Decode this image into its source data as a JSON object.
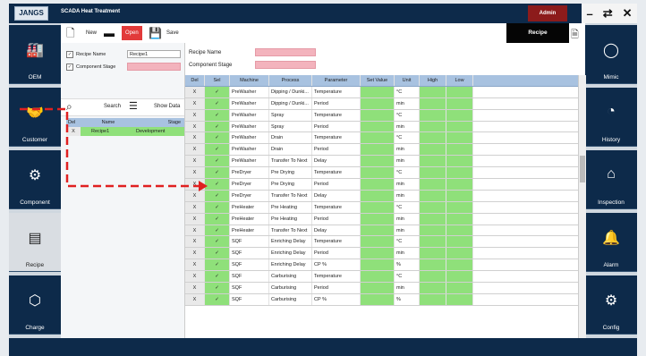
{
  "app": {
    "logo": "JANGS",
    "title": "SCADA Heat Treatment",
    "user_badge": "Admin"
  },
  "window_controls": {
    "minimize": "–",
    "restore": "⇄",
    "close": "✕"
  },
  "left_nav": [
    {
      "label": "OEM",
      "icon": "factory-icon",
      "glyph": "🏭",
      "active": false
    },
    {
      "label": "Customer",
      "icon": "customer-icon",
      "glyph": "🤝",
      "active": false
    },
    {
      "label": "Component",
      "icon": "component-icon",
      "glyph": "⚙",
      "active": false
    },
    {
      "label": "Recipe",
      "icon": "recipe-icon",
      "glyph": "▤",
      "active": true
    },
    {
      "label": "Charge",
      "icon": "charge-icon",
      "glyph": "⬡",
      "active": false
    }
  ],
  "right_nav": [
    {
      "label": "Mimic",
      "icon": "mimic-icon",
      "glyph": "◯"
    },
    {
      "label": "History",
      "icon": "history-icon",
      "glyph": "◔"
    },
    {
      "label": "Inspection",
      "icon": "inspection-icon",
      "glyph": "⌂"
    },
    {
      "label": "Alarm",
      "icon": "alarm-icon",
      "glyph": "🔔"
    },
    {
      "label": "Config",
      "icon": "config-icon",
      "glyph": "⚙"
    }
  ],
  "toolbar": {
    "new_label": "New",
    "open_label": "Open",
    "save_label": "Save",
    "section_title": "Recipe"
  },
  "left_panel": {
    "recipe_name_label": "Recipe Name",
    "recipe_name_value": "Recipe1",
    "component_stage_label": "Component Stage",
    "search_label": "Search",
    "show_data_label": "Show Data",
    "table_headers": {
      "del": "Del",
      "name": "Name",
      "stage": "Stage"
    },
    "rows": [
      {
        "del": "X",
        "name": "Recipe1",
        "stage": "Development"
      }
    ]
  },
  "form": {
    "recipe_name_label": "Recipe Name",
    "component_stage_label": "Component Stage"
  },
  "grid": {
    "headers": {
      "del": "Del",
      "sel": "Sel",
      "machine": "Machine",
      "process": "Process",
      "parameter": "Parameter",
      "set_value": "Set Value",
      "unit": "Unit",
      "high": "High",
      "low": "Low"
    },
    "rows": [
      {
        "del": "X",
        "sel": "✓",
        "machine": "PreWasher",
        "process": "Dipping / Dunki...",
        "parameter": "Temperature",
        "unit": "°C"
      },
      {
        "del": "X",
        "sel": "✓",
        "machine": "PreWasher",
        "process": "Dipping / Dunki...",
        "parameter": "Period",
        "unit": "min"
      },
      {
        "del": "X",
        "sel": "✓",
        "machine": "PreWasher",
        "process": "Spray",
        "parameter": "Temperature",
        "unit": "°C"
      },
      {
        "del": "X",
        "sel": "✓",
        "machine": "PreWasher",
        "process": "Spray",
        "parameter": "Period",
        "unit": "min"
      },
      {
        "del": "X",
        "sel": "✓",
        "machine": "PreWasher",
        "process": "Drain",
        "parameter": "Temperature",
        "unit": "°C"
      },
      {
        "del": "X",
        "sel": "✓",
        "machine": "PreWasher",
        "process": "Drain",
        "parameter": "Period",
        "unit": "min"
      },
      {
        "del": "X",
        "sel": "✓",
        "machine": "PreWasher",
        "process": "Transfer To Next",
        "parameter": "Delay",
        "unit": "min"
      },
      {
        "del": "X",
        "sel": "✓",
        "machine": "PreDryer",
        "process": "Pre Drying",
        "parameter": "Temperature",
        "unit": "°C"
      },
      {
        "del": "X",
        "sel": "✓",
        "machine": "PreDryer",
        "process": "Pre Drying",
        "parameter": "Period",
        "unit": "min"
      },
      {
        "del": "X",
        "sel": "✓",
        "machine": "PreDryer",
        "process": "Transfer To Next",
        "parameter": "Delay",
        "unit": "min"
      },
      {
        "del": "X",
        "sel": "✓",
        "machine": "PreHeater",
        "process": "Pre Heating",
        "parameter": "Temperature",
        "unit": "°C"
      },
      {
        "del": "X",
        "sel": "✓",
        "machine": "PreHeater",
        "process": "Pre Heating",
        "parameter": "Period",
        "unit": "min"
      },
      {
        "del": "X",
        "sel": "✓",
        "machine": "PreHeater",
        "process": "Transfer To Next",
        "parameter": "Delay",
        "unit": "min"
      },
      {
        "del": "X",
        "sel": "✓",
        "machine": "SQF",
        "process": "Enriching Delay",
        "parameter": "Temperature",
        "unit": "°C"
      },
      {
        "del": "X",
        "sel": "✓",
        "machine": "SQF",
        "process": "Enriching Delay",
        "parameter": "Period",
        "unit": "min"
      },
      {
        "del": "X",
        "sel": "✓",
        "machine": "SQF",
        "process": "Enriching Delay",
        "parameter": "CP %",
        "unit": "%"
      },
      {
        "del": "X",
        "sel": "✓",
        "machine": "SQF",
        "process": "Carburising",
        "parameter": "Temperature",
        "unit": "°C"
      },
      {
        "del": "X",
        "sel": "✓",
        "machine": "SQF",
        "process": "Carburising",
        "parameter": "Period",
        "unit": "min"
      },
      {
        "del": "X",
        "sel": "✓",
        "machine": "SQF",
        "process": "Carburising",
        "parameter": "CP %",
        "unit": "%"
      }
    ]
  },
  "colors": {
    "navy": "#0d2a4a",
    "accent_red": "#e23a3a",
    "green": "#8fe07a",
    "pink": "#f3b3bd",
    "header_blue": "#a8c2e0",
    "annotation": "#e02020"
  }
}
